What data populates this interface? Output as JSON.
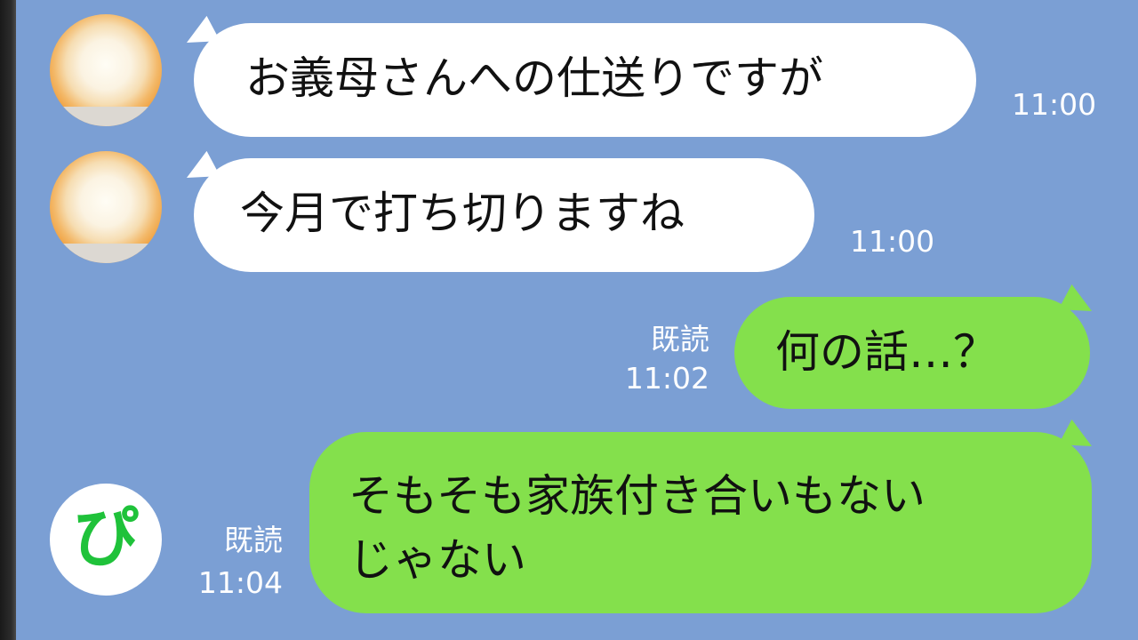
{
  "colors": {
    "background": "#7b9fd4",
    "incoming_bubble": "#ffffff",
    "outgoing_bubble": "#84e04c",
    "meta_text": "#ffffff",
    "pi_icon": "#1fc23a"
  },
  "messages": [
    {
      "direction": "incoming",
      "avatar_icon": "cake-avatar-icon",
      "text": "お義母さんへの仕送りですが",
      "time": "11:00"
    },
    {
      "direction": "incoming",
      "avatar_icon": "cake-avatar-icon",
      "text": "今月で打ち切りますね",
      "time": "11:00"
    },
    {
      "direction": "outgoing",
      "text": "何の話…？",
      "read": "既読",
      "time": "11:02"
    },
    {
      "direction": "outgoing",
      "text_line1": "そもそも家族付き合いもない",
      "text_line2": "じゃない",
      "read": "既読",
      "time": "11:04"
    }
  ],
  "pi_avatar": {
    "icon": "pi-logo-icon",
    "glyph": "ぴ"
  }
}
